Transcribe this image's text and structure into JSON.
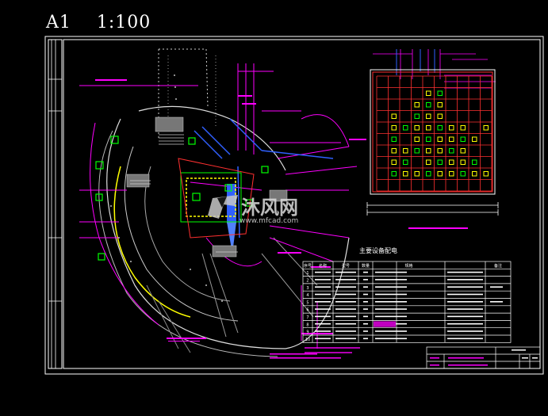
{
  "sheet": {
    "size_label": "A1",
    "scale_label": "1:100"
  },
  "equipment_table": {
    "title": "主要设备配电",
    "headers": [
      "序号",
      "名称",
      "型号",
      "数量",
      "规格",
      "",
      "备注"
    ],
    "rows": [
      {
        "no": "1",
        "spec": "",
        "note": ""
      },
      {
        "no": "2",
        "spec": "",
        "note": ""
      },
      {
        "no": "3",
        "spec": "",
        "note": ""
      },
      {
        "no": "4",
        "spec": "",
        "note": ""
      },
      {
        "no": "5",
        "spec": "",
        "note": ""
      },
      {
        "no": "6",
        "spec": "",
        "note": ""
      },
      {
        "no": "7",
        "spec": "",
        "note": ""
      },
      {
        "no": "8",
        "spec": "",
        "note": ""
      },
      {
        "no": "9",
        "spec": "",
        "note": ""
      },
      {
        "no": "10",
        "spec": "",
        "note": ""
      }
    ]
  },
  "watermark": {
    "text": "沐风网",
    "url": "www.mfcad.com"
  },
  "colors": {
    "background": "#000000",
    "frame": "#ffffff",
    "cad_magenta": "#ff00ff",
    "cad_red": "#ff0000",
    "cad_yellow": "#ffff00",
    "cad_green": "#00ff00",
    "cad_blue": "#3060ff",
    "cad_cyan": "#00c8ff"
  }
}
